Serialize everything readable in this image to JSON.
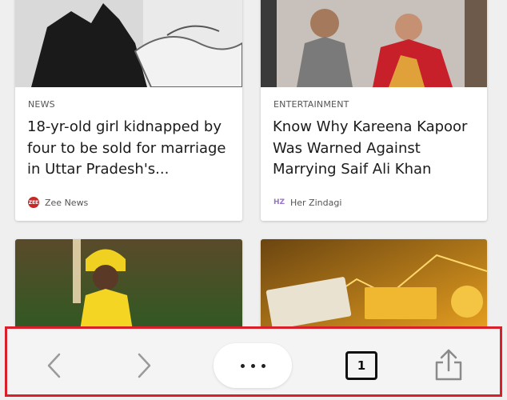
{
  "cards": [
    {
      "category": "NEWS",
      "headline_lines": [
        "18-yr-old girl kidnapped by",
        "four to be sold for marriage",
        "in Uttar Pradesh's..."
      ],
      "source": "Zee News",
      "source_logo_text": "ZEE",
      "source_logo_color": "#c62828"
    },
    {
      "category": "ENTERTAINMENT",
      "headline_lines": [
        "Know Why Kareena Kapoor",
        "Was Warned Against",
        "Marrying Saif Ali Khan"
      ],
      "source": "Her Zindagi",
      "source_logo_text": "HZ",
      "source_logo_color": "#b39ddb"
    }
  ],
  "toolbar": {
    "tab_count": "1",
    "highlight_color": "#d81f2a"
  },
  "icons": {
    "back": "chevron-left-icon",
    "forward": "chevron-right-icon",
    "more": "more-dots-icon",
    "tabs": "tabs-icon",
    "share": "share-icon"
  }
}
